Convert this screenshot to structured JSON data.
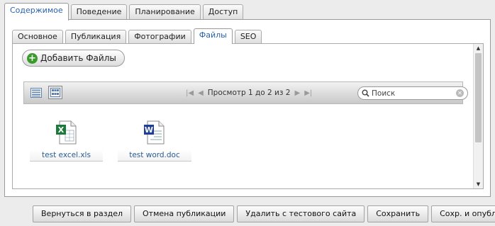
{
  "top_tabs": [
    "Содержимое",
    "Поведение",
    "Планирование",
    "Доступ"
  ],
  "sub_tabs": [
    "Основное",
    "Публикация",
    "Фотографии",
    "Файлы",
    "SEO"
  ],
  "add_files_label": "Добавить Файлы",
  "pager": {
    "text": "Просмотр 1 до 2 из 2"
  },
  "search": {
    "placeholder": "Поиск",
    "value": ""
  },
  "files": [
    {
      "name": "test excel.xls",
      "icon": "excel-file-icon"
    },
    {
      "name": "test word.doc",
      "icon": "word-file-icon"
    }
  ],
  "buttons": {
    "back": "Вернуться в раздел",
    "cancel_publish": "Отмена публикации",
    "delete_test": "Удалить с тестового сайта",
    "save": "Сохранить",
    "save_publish": "Сохр. и опублик."
  },
  "colors": {
    "accent": "#2b63a8",
    "link": "#2b5c93",
    "add_green": "#3a9b2c"
  }
}
